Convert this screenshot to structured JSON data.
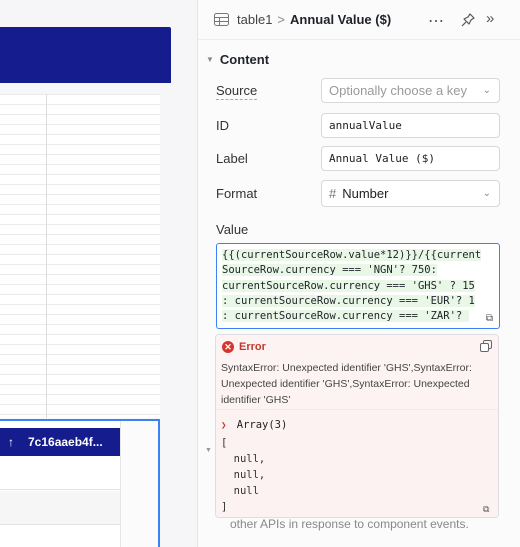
{
  "header": {
    "breadcrumb_parent": "table1",
    "separator": ">",
    "title": "Annual Value ($)"
  },
  "content_section": {
    "title": "Content",
    "source": {
      "label": "Source",
      "placeholder": "Optionally choose a key"
    },
    "id": {
      "label": "ID",
      "value": "annualValue"
    },
    "label_field": {
      "label": "Label",
      "value": "Annual Value ($)"
    },
    "format": {
      "label": "Format",
      "value": "Number"
    },
    "value": {
      "label": "Value",
      "code_lines": [
        "{{(currentSourceRow.value*12)}}/{{current",
        "SourceRow.currency === 'NGN'? 750:",
        "currentSourceRow.currency === 'GHS' ? 15",
        ": currentSourceRow.currency === 'EUR'? 1",
        ": currentSourceRow.currency === 'ZAR'? "
      ]
    }
  },
  "error_panel": {
    "title": "Error",
    "message": "SyntaxError: Unexpected identifier 'GHS',SyntaxError: Unexpected identifier 'GHS',SyntaxError: Unexpected identifier 'GHS'",
    "array_title": "Array(3)",
    "array_lines": [
      "[",
      "  null,",
      "  null,",
      "  null",
      "]"
    ]
  },
  "footer_text": "other APIs in response to component events.",
  "canvas": {
    "selected_column_header": "7c16aaeb4f..."
  },
  "colors": {
    "navy": "#141c8e",
    "selection_blue": "#3a82f6",
    "error_red": "#d9342b",
    "error_bg": "#fdf3f3"
  }
}
